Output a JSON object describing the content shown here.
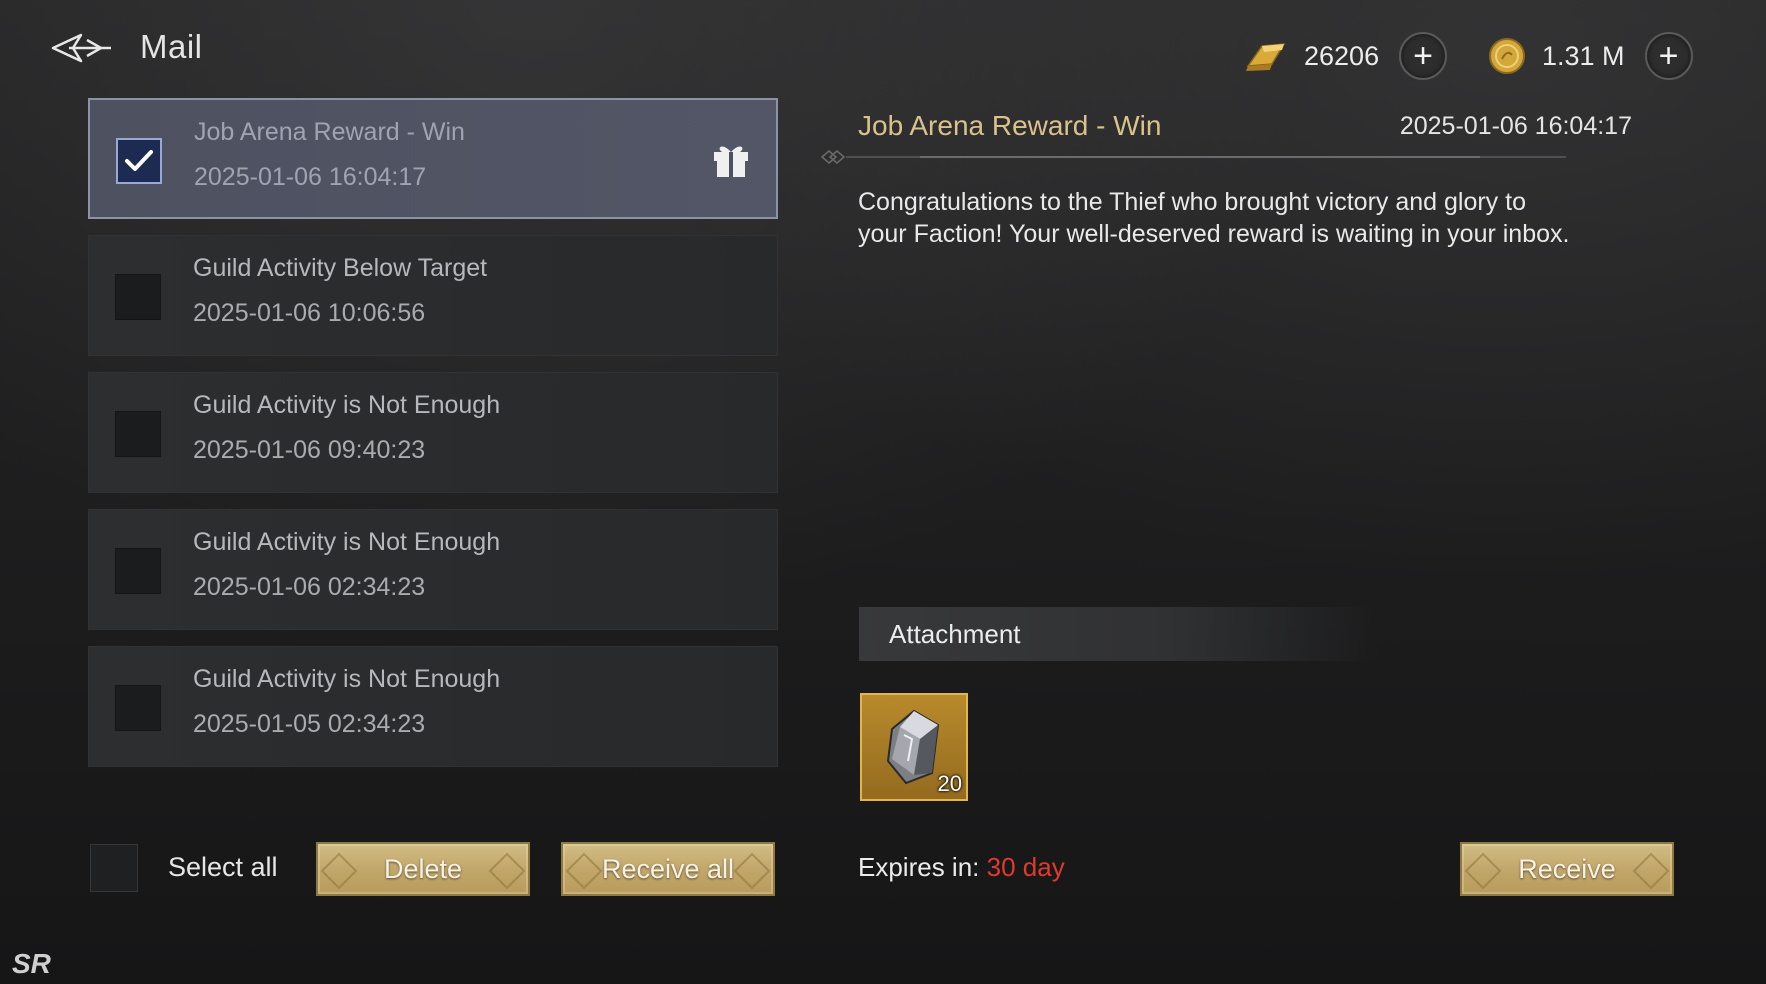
{
  "header": {
    "title": "Mail",
    "currency_1": {
      "icon": "gold-ingot-icon",
      "amount": "26206"
    },
    "currency_2": {
      "icon": "gold-coin-icon",
      "amount": "1.31 M"
    }
  },
  "mails": [
    {
      "subject": "Job Arena Reward - Win",
      "date": "2025-01-06 16:04:17",
      "selected": true,
      "has_gift": true
    },
    {
      "subject": "Guild Activity Below Target",
      "date": "2025-01-06 10:06:56",
      "selected": false,
      "has_gift": false
    },
    {
      "subject": "Guild Activity is Not Enough",
      "date": "2025-01-06 09:40:23",
      "selected": false,
      "has_gift": false
    },
    {
      "subject": "Guild Activity is Not Enough",
      "date": "2025-01-06 02:34:23",
      "selected": false,
      "has_gift": false
    },
    {
      "subject": "Guild Activity is Not Enough",
      "date": "2025-01-05 02:34:23",
      "selected": false,
      "has_gift": false
    }
  ],
  "controls": {
    "select_all_label": "Select all",
    "delete_label": "Delete",
    "receive_all_label": "Receive all"
  },
  "detail": {
    "subject": "Job Arena Reward - Win",
    "date": "2025-01-06 16:04:17",
    "body": "Congratulations to the Thief who brought victory and glory to your Faction! Your well-deserved reward is waiting in your inbox.",
    "attachment_label": "Attachment",
    "attachment_item": {
      "icon": "crystal-icon",
      "quantity": "20"
    },
    "expires_label": "Expires in:",
    "expires_value": "30 day",
    "receive_label": "Receive"
  },
  "colors": {
    "accent_gold": "#d9c28b",
    "expire_red": "#e03a2e",
    "button_gold": "#c2a76a"
  }
}
